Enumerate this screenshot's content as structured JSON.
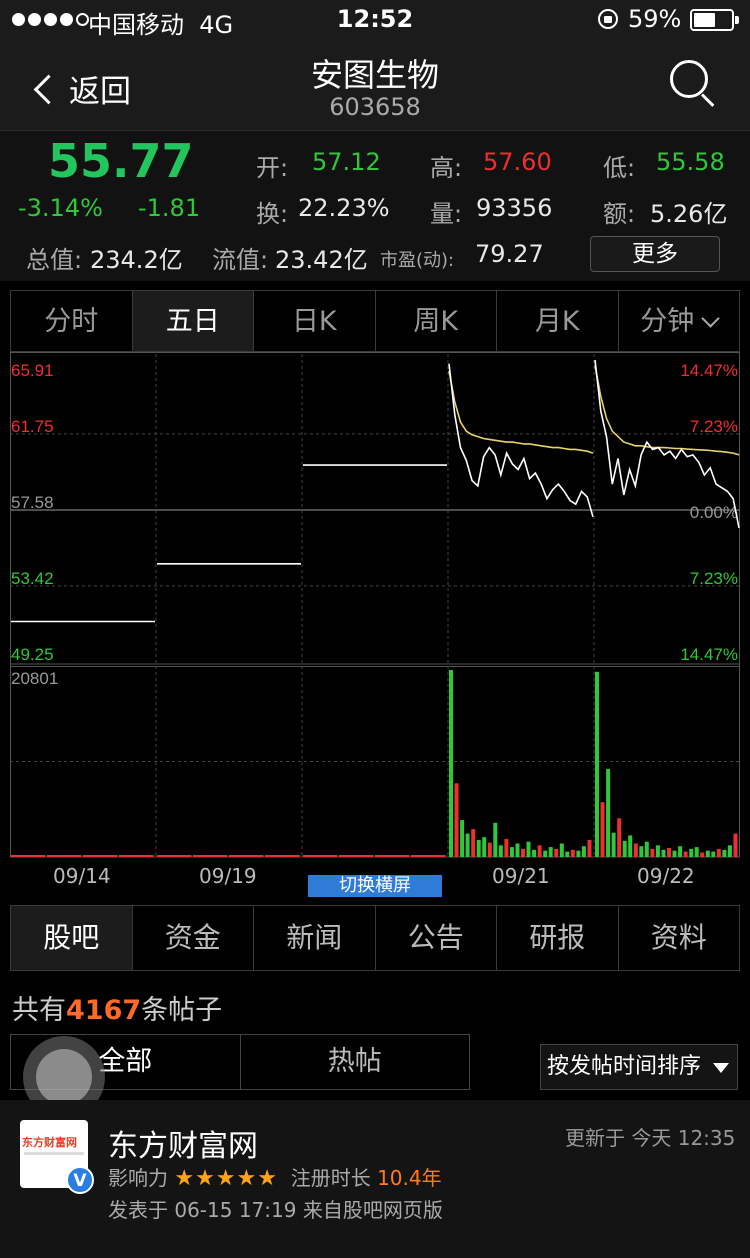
{
  "status_bar": {
    "carrier": "中国移动",
    "network": "4G",
    "time": "12:52",
    "battery_pct": "59%",
    "battery_level": 0.59
  },
  "nav": {
    "back_label": "返回",
    "title": "安图生物",
    "code": "603658"
  },
  "quote": {
    "price": "55.77",
    "change_pct": "-3.14%",
    "change": "-1.81",
    "open_label": "开:",
    "open": "57.12",
    "high_label": "高:",
    "high": "57.60",
    "low_label": "低:",
    "low": "55.58",
    "turnover_label": "换:",
    "turnover": "22.23%",
    "volume_label": "量:",
    "volume": "93356",
    "amount_label": "额:",
    "amount": "5.26亿",
    "total_mv_label": "总值:",
    "total_mv": "234.2亿",
    "float_mv_label": "流值:",
    "float_mv": "23.42亿",
    "pe_label": "市盈(动):",
    "pe": "79.27",
    "more_label": "更多"
  },
  "chart_tabs": [
    {
      "label": "分时"
    },
    {
      "label": "五日"
    },
    {
      "label": "日K"
    },
    {
      "label": "周K"
    },
    {
      "label": "月K"
    },
    {
      "label": "分钟"
    }
  ],
  "colors": {
    "up": "#ef2f2f",
    "down": "#2ec83a",
    "avg_line": "#e8d36a",
    "price_line": "#ffffff",
    "toggle": "#2f7bd8"
  },
  "chart_data": {
    "type": "line",
    "y_left_ticks": [
      "65.91",
      "61.75",
      "57.58",
      "53.42",
      "49.25"
    ],
    "y_right_ticks": [
      "14.47%",
      "7.23%",
      "0.00%",
      "7.23%",
      "14.47%"
    ],
    "volume_max_label": "20801",
    "x_dates": [
      "09/14",
      "09/19",
      "09/21",
      "09/22"
    ],
    "days": [
      {
        "price": [
          51.47,
          51.47
        ]
      },
      {
        "price": [
          54.63,
          54.63
        ]
      },
      {
        "price": [
          60.04,
          60.04
        ]
      },
      {
        "price": [
          65.6,
          62.8,
          61.0,
          60.3,
          59.2,
          58.9,
          60.5,
          61.0,
          60.6,
          59.5,
          60.7,
          60.1,
          59.8,
          60.4,
          59.3,
          59.6,
          59.0,
          58.2,
          58.7,
          59.0,
          58.6,
          58.1,
          57.9,
          58.6,
          58.3,
          57.2
        ],
        "avg": [
          65.2,
          63.5,
          62.4,
          61.9,
          61.7,
          61.6,
          61.5,
          61.45,
          61.4,
          61.35,
          61.3,
          61.3,
          61.25,
          61.2,
          61.2,
          61.15,
          61.1,
          61.05,
          61.0,
          61.0,
          60.95,
          60.9,
          60.9,
          60.85,
          60.8,
          60.7
        ]
      },
      {
        "price": [
          65.8,
          63.0,
          61.6,
          59.0,
          60.4,
          58.4,
          59.8,
          58.9,
          60.6,
          61.3,
          60.9,
          61.0,
          60.6,
          60.8,
          60.4,
          60.9,
          60.5,
          60.6,
          60.2,
          59.5,
          59.9,
          59.0,
          58.8,
          58.6,
          58.2,
          56.6
        ],
        "avg": [
          65.5,
          63.8,
          62.6,
          61.9,
          61.6,
          61.3,
          61.2,
          61.1,
          61.1,
          61.05,
          61.0,
          61.0,
          61.0,
          60.98,
          60.95,
          60.95,
          60.92,
          60.9,
          60.88,
          60.86,
          60.84,
          60.8,
          60.78,
          60.74,
          60.7,
          60.6
        ]
      }
    ],
    "volume": [
      [
        0,
        0,
        0,
        0
      ],
      [
        0,
        0,
        0,
        0
      ],
      [
        0,
        0,
        0,
        0
      ],
      [
        20801,
        8200,
        4100,
        2600,
        3100,
        1900,
        2200,
        1600,
        3800,
        1300,
        2000,
        1100,
        1500,
        900,
        1700,
        800,
        1300,
        700,
        1100,
        900,
        1500,
        600,
        800,
        700,
        1200,
        1900
      ],
      [
        20601,
        6100,
        9800,
        2700,
        4300,
        1800,
        2400,
        1500,
        1200,
        1700,
        900,
        1300,
        800,
        1000,
        700,
        1200,
        600,
        900,
        1100,
        500,
        700,
        600,
        900,
        800,
        1300,
        2600
      ]
    ]
  },
  "toggle_label": "切换横屏",
  "info_tabs": [
    {
      "label": "股吧"
    },
    {
      "label": "资金"
    },
    {
      "label": "新闻"
    },
    {
      "label": "公告"
    },
    {
      "label": "研报"
    },
    {
      "label": "资料"
    }
  ],
  "posts_prefix": "共有",
  "posts_count": "4167",
  "posts_suffix": "条帖子",
  "filter": {
    "all": "全部",
    "hot": "热帖"
  },
  "sort_label": "按发帖时间排序",
  "post": {
    "logo_text": "东方财富网",
    "badge": "V",
    "author": "东方财富网",
    "updated": "更新于 今天 12:35",
    "influence_label": "影响力",
    "stars": "★★★★★",
    "reg_label": "注册时长",
    "reg_value": "10.4年",
    "posted": "发表于 06-15 17:19  来自股吧网页版"
  }
}
